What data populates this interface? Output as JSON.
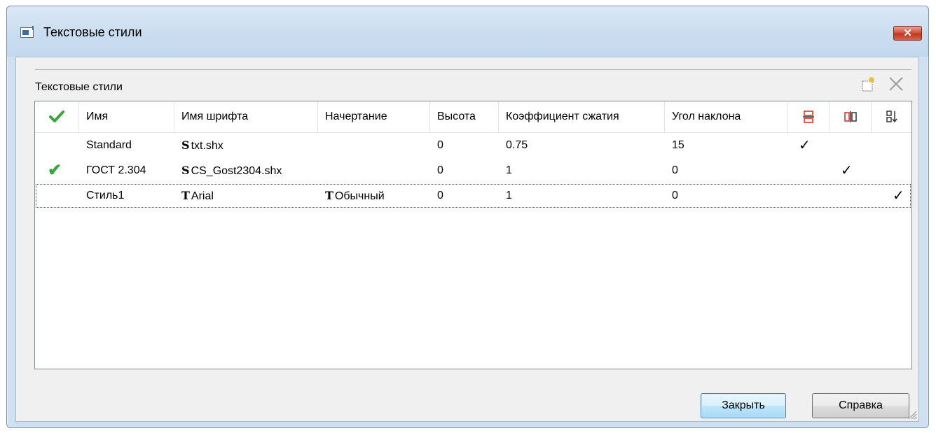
{
  "window": {
    "title": "Текстовые стили",
    "close_label": "✕"
  },
  "group": {
    "label": "Текстовые стили",
    "new_style_icon": "new-style-icon",
    "delete_icon": "delete-icon"
  },
  "table": {
    "headers": {
      "name": "Имя",
      "font": "Имя шрифта",
      "style": "Начертание",
      "height": "Высота",
      "width_factor": "Коэффициент сжатия",
      "oblique": "Угол наклона"
    },
    "rows": [
      {
        "current": "",
        "name": "Standard",
        "font_tag": "S",
        "font": "txt.shx",
        "style_tag": "",
        "style": "",
        "height": "0",
        "width_factor": "0.75",
        "oblique": "15",
        "c1": "✓",
        "c2": "",
        "c3": ""
      },
      {
        "current": "✔",
        "name": "ГОСТ 2.304",
        "font_tag": "S",
        "font": "CS_Gost2304.shx",
        "style_tag": "",
        "style": "",
        "height": "0",
        "width_factor": "1",
        "oblique": "0",
        "c1": "",
        "c2": "✓",
        "c3": ""
      },
      {
        "current": "",
        "name": "Стиль1",
        "font_tag": "T",
        "font": "Arial",
        "style_tag": "T",
        "style": "Обычный",
        "height": "0",
        "width_factor": "1",
        "oblique": "0",
        "c1": "",
        "c2": "",
        "c3": "✓"
      }
    ]
  },
  "buttons": {
    "close": "Закрыть",
    "help": "Справка"
  }
}
